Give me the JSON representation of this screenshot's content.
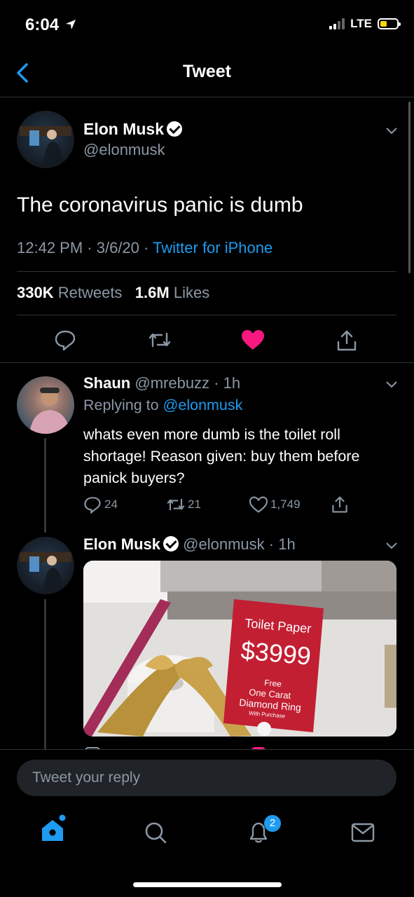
{
  "status_bar": {
    "time": "6:04",
    "network": "LTE"
  },
  "header": {
    "title": "Tweet"
  },
  "tweet": {
    "author_name": "Elon Musk",
    "author_handle": "@elonmusk",
    "text": "The coronavirus panic is dumb",
    "time": "12:42 PM · 3/6/20 · ",
    "source": "Twitter for iPhone",
    "retweets_count": "330K",
    "retweets_label": "Retweets",
    "likes_count": "1.6M",
    "likes_label": "Likes"
  },
  "replies": [
    {
      "author_name": "Shaun",
      "author_handle": "@mrebuzz",
      "age": "· 1h",
      "replying_prefix": "Replying to ",
      "replying_to": "@elonmusk",
      "text": "whats even more dumb is the toilet roll shortage! Reason given: buy them before panick buyers?",
      "reply_count": "24",
      "retweet_count": "21",
      "like_count": "1,749"
    },
    {
      "author_name": "Elon Musk",
      "author_handle": "@elonmusk",
      "age": "· 1h",
      "photo": {
        "sign_title": "Toilet Paper",
        "sign_price": "$3999",
        "sign_line1": "Free",
        "sign_line2": "One Carat",
        "sign_line3": "Diamond Ring",
        "sign_line4": "With Purchase"
      }
    }
  ],
  "composer": {
    "placeholder": "Tweet your reply"
  },
  "tab_bar": {
    "notifications_badge": "2"
  },
  "colors": {
    "accent": "#1d9bf0",
    "like": "#f91880",
    "background": "#000000"
  }
}
